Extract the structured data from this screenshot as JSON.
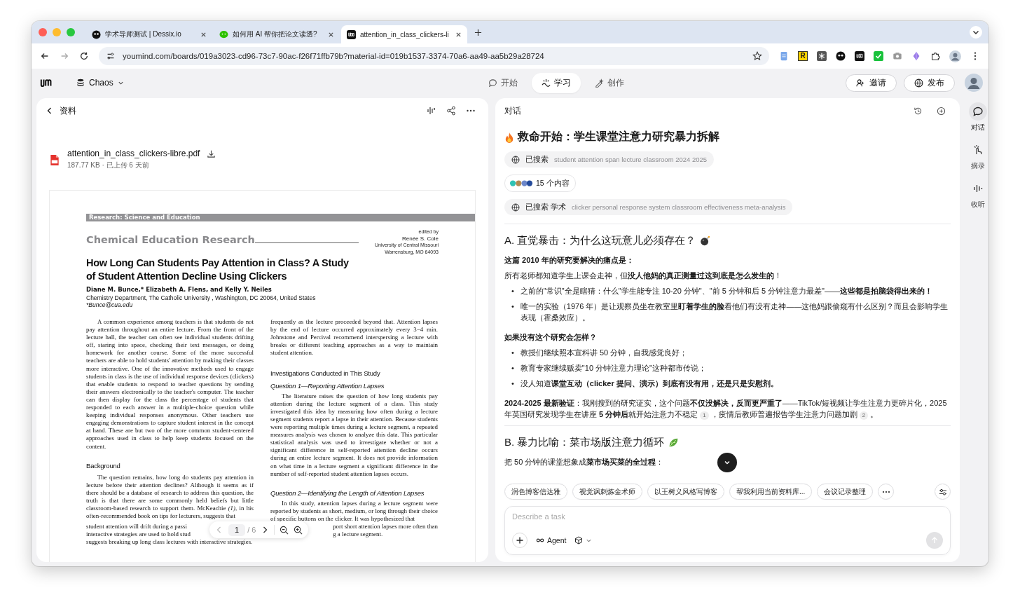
{
  "browser": {
    "tabs": [
      {
        "title": "学术导师测试 | Dessix.io",
        "kind": "mask",
        "selected": false
      },
      {
        "title": "如何用 AI 帮你把论文读透?",
        "kind": "chat",
        "selected": false
      },
      {
        "title": "attention_in_class_clickers-li",
        "kind": "app",
        "selected": true
      }
    ],
    "url": "youmind.com/boards/019a3023-cd96-73c7-90ac-f26f71ffb79b?material-id=019b1537-3374-70a6-aa49-aa5b29a28724",
    "extension_letter": "R"
  },
  "header": {
    "board": "Chaos",
    "modes": [
      {
        "label": "开始",
        "kind": "chat",
        "selected": false
      },
      {
        "label": "学习",
        "kind": "learn",
        "selected": true
      },
      {
        "label": "创作",
        "kind": "create",
        "selected": false
      }
    ],
    "actions": [
      {
        "label": "邀请",
        "kind": "invite"
      },
      {
        "label": "发布",
        "kind": "publish"
      }
    ]
  },
  "material": {
    "title": "资料",
    "file_name": "attention_in_class_clickers-libre.pdf",
    "file_meta": "187.77 KB · 已上传 6 天前",
    "pdf": {
      "banner": "Research: Science and Education",
      "journal": "Chemical Education Research",
      "editor": [
        "edited by",
        "Renée S. Cole",
        "University of Central Missouri",
        "Warrensburg, MO 64093"
      ],
      "title": "How Long Can Students Pay Attention in Class? A Study of Student Attention Decline Using Clickers",
      "authors": "Diane M. Bunce,* Elizabeth A. Flens, and Kelly Y. Neiles",
      "affiliation": "Chemistry Department, The Catholic University , Washington, DC 20064, United States",
      "email": "*Bunce@cua.edu",
      "columns": [
        [
          {
            "kind": "para",
            "text": "A common experience among teachers is that students do not pay attention throughout an entire lecture. From the front of the lecture hall, the teacher can often see individual students drifting off, staring into space, checking their text messages, or doing homework for another course. Some of the more successful teachers are able to hold students' attention by making their classes more interactive. One of the innovative methods used to engage students in class is the use of individual response devices (clickers) that enable students to respond to teacher questions by sending their answers electronically to the teacher's computer. The teacher can then display for the class the percentage of students that responded to each answer in a multiple-choice question while keeping individual responses anonymous. Other teachers use engaging demonstrations to capture student interest in the concept at hand. These are but two of the more common student-centered approaches used in class to help keep students focused on the content."
          },
          {
            "kind": "heading",
            "text": "Background"
          },
          {
            "kind": "para",
            "text": "The question remains, how long do students pay attention in lecture before their attention declines? Although it seems as if there should be a database of research to address this question, the truth is that there are some commonly held beliefs but little classroom-based research to support them. McKeachie *(1)*, in his often-recommended book on tips for lecturers, suggests that",
            "lines": [
              "student attention will drift during a passi",
              "interactive strategies are used to hold stud",
              "suggests breaking up long class lectures with interactive strategies."
            ]
          }
        ],
        [
          {
            "kind": "cont",
            "text": "frequently as the lecture proceeded beyond that. Attention lapses by the end of lecture occurred approximately every 3−4 min. Johnstone and Percival recommend interspersing a lecture with breaks or different teaching approaches as a way to maintain student attention."
          },
          {
            "kind": "heading",
            "text": "Investigations Conducted in This Study"
          },
          {
            "kind": "subheading",
            "text": "Question 1—Reporting Attention Lapses"
          },
          {
            "kind": "para",
            "text": "The literature raises the question of how long students pay attention during the lecture segment of a class. This study investigated this idea by measuring how often during a lecture segment students report a lapse in their attention. Because students were reporting multiple times during a lecture segment, a repeated measures analysis was chosen to analyze this data. This particular statistical analysis was used to investigate whether or not a significant difference in self-reported attention decline occurs during an entire lecture segment. It does not provide information on what time in a lecture segment a significant difference in the number of self-reported student attention lapses occurs."
          },
          {
            "kind": "subheading",
            "text": "Question 2—Identifying the Length of Attention Lapses"
          },
          {
            "kind": "para",
            "text": "In this study, attention lapses during a lecture segment were reported by students as short, medium, or long through their choice of specific buttons on the clicker. It was hypothesized that",
            "lines": [
              "port short attention lapses more often than",
              "g a lecture segment."
            ]
          }
        ]
      ]
    },
    "pager": {
      "page": "1",
      "total": "/ 6"
    }
  },
  "chat": {
    "title": "对话",
    "heading": "救命开始：学生课堂注意力研究暴力拆解",
    "steps": [
      {
        "kind": "search",
        "label": "已搜索",
        "query": "student attention span lecture classroom 2024 2025"
      },
      {
        "kind": "sources",
        "label": "15 个内容"
      },
      {
        "kind": "search",
        "label": "已搜索 学术",
        "query": "clicker personal response system classroom effectiveness meta-analysis"
      }
    ],
    "sections": [
      {
        "heading": "A. 直觉暴击：为什么这玩意儿必须存在？",
        "blocks": [
          {
            "kind": "lead",
            "text": "这篇 2010 年的研究要解决的痛点是："
          },
          {
            "kind": "p",
            "text": "所有老师都知道学生上课会走神，但**没人他妈的真正测量过这到底是怎么发生的**！"
          },
          {
            "kind": "ul",
            "bullet": "•",
            "items": [
              "之前的\"常识\"全是瞎猜：什么\"学生能专注 10-20 分钟\"、\"前 5 分钟和后 5 分钟注意力最差\"——**这些都是拍脑袋得出来的！**",
              "唯一的实验（1976 年）是让观察员坐在教室里**盯着学生的脸**看他们有没有走神——这他妈跟偷窥有什么区别？而且会影响学生表现（霍桑效应）。"
            ]
          },
          {
            "kind": "lead",
            "text": "如果没有这个研究会怎样？"
          },
          {
            "kind": "ul",
            "bullet": "•",
            "items": [
              "教授们继续照本宣科讲 50 分钟，自我感觉良好；",
              "教育专家继续贩卖\"10 分钟注意力理论\"这种都市传说；",
              "没人知道**课堂互动（clicker 提问、演示）到底有没有用，还是只是安慰剂。**"
            ]
          },
          {
            "kind": "cited",
            "parts": [
              {
                "kind": "text",
                "text": "**2024-2025 最新验证**：我刚搜到的研究证实，这个问题**不仅没解决，反而更严重了**——TikTok/短视频让学生注意力更碎片化，2025 年英国研究发现学生在讲座 **5 分钟后**就开始注意力不稳定"
              },
              {
                "kind": "cite",
                "text": "1"
              },
              {
                "kind": "text",
                "text": "，疫情后教师普遍报告学生注意力问题加剧"
              },
              {
                "kind": "cite",
                "text": "2"
              },
              {
                "kind": "text",
                "text": "。"
              }
            ]
          }
        ]
      },
      {
        "heading": "B. 暴力比喻：菜市场版注意力循环",
        "blocks": [
          {
            "kind": "p",
            "text": "把 50 分钟的课堂想象成**菜市场买菜的全过程**："
          }
        ]
      }
    ],
    "suggestions": [
      "润色博客信达雅",
      "视觉讽刺炼金术师",
      "以王树义风格写博客",
      "帮我利用当前资料库...",
      "会议记录整理"
    ],
    "input": {
      "placeholder": "Describe a task",
      "mode": "Agent"
    }
  },
  "side_nav": [
    {
      "label": "对话",
      "kind": "chat",
      "selected": true
    },
    {
      "label": "摘录",
      "kind": "excerpt",
      "selected": false
    },
    {
      "label": "收听",
      "kind": "listen",
      "selected": false
    }
  ]
}
